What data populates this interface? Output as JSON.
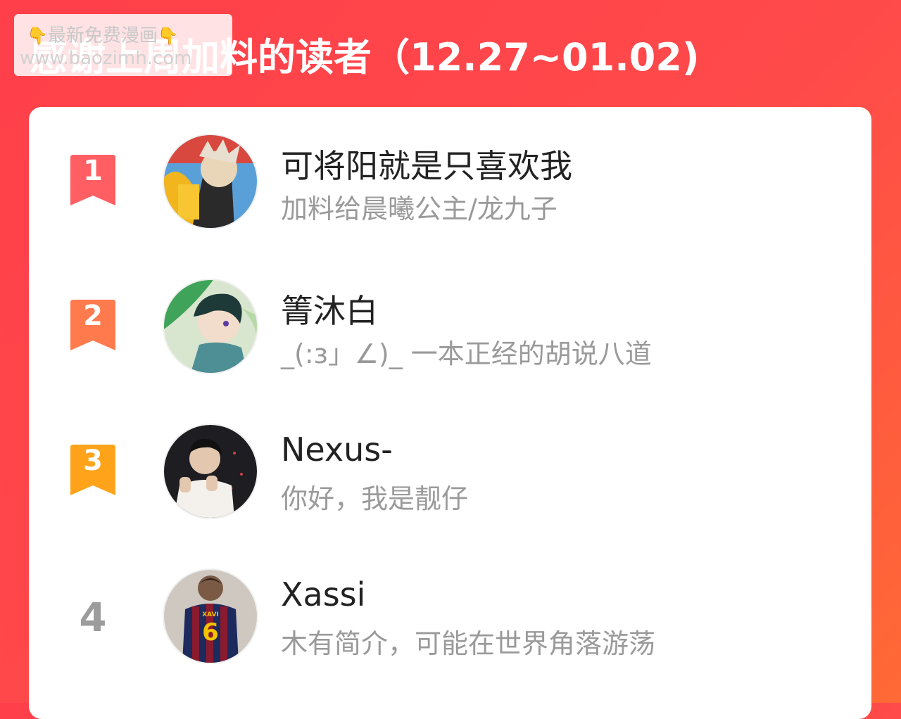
{
  "header": {
    "title": "感谢上周加料的读者（12.27~01.02)"
  },
  "watermark": {
    "line1": "最新免费漫画",
    "line2": "www.baozimh.com",
    "hand_icon": "pointing-down-hand-icon"
  },
  "colors": {
    "background_start": "#ff3f4a",
    "background_end": "#ff6a35",
    "rank1": "#ff5e63",
    "rank2": "#ff7a4d",
    "rank3": "#ffa31a",
    "rank_plain": "#9c9c9c"
  },
  "readers": [
    {
      "rank": "1",
      "name": "可将阳就是只喜欢我",
      "desc": "加料给晨曦公主/龙九子",
      "avatar_icon": "anime-character-avatar-icon"
    },
    {
      "rank": "2",
      "name": "箐沐白",
      "desc": "_(:з」∠)_ 一本正经的胡说八道",
      "avatar_icon": "anime-boy-avatar-icon"
    },
    {
      "rank": "3",
      "name": "Nexus-",
      "desc": "你好，我是靓仔",
      "avatar_icon": "person-photo-avatar-icon"
    },
    {
      "rank": "4",
      "name": "Xassi",
      "desc": "木有简介，可能在世界角落游荡",
      "avatar_icon": "football-player-avatar-icon"
    }
  ]
}
